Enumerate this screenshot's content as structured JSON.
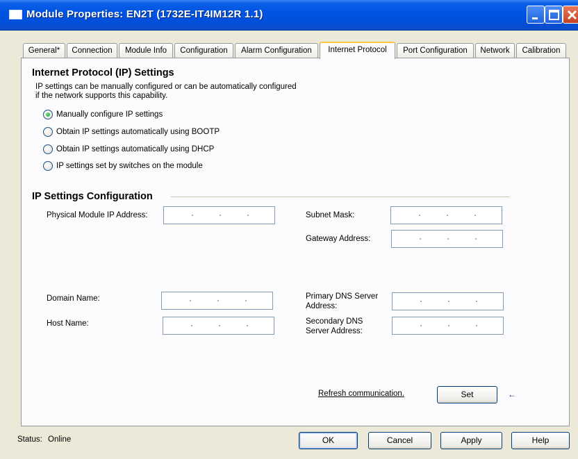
{
  "window": {
    "title": "Module Properties: EN2T (1732E-IT4IM12R 1.1)",
    "icon": "window-app-icon"
  },
  "tabs": [
    {
      "label": "General*"
    },
    {
      "label": "Connection"
    },
    {
      "label": "Module Info"
    },
    {
      "label": "Configuration"
    },
    {
      "label": "Alarm Configuration"
    },
    {
      "label": "Internet Protocol",
      "active": true
    },
    {
      "label": "Port Configuration"
    },
    {
      "label": "Network"
    },
    {
      "label": "Calibration"
    }
  ],
  "ip_settings": {
    "heading": "Internet Protocol (IP) Settings",
    "description_line1": "IP settings can be manually configured or can be automatically configured",
    "description_line2": "if the network supports this capability.",
    "options": [
      {
        "label": "Manually configure IP settings",
        "checked": true
      },
      {
        "label": "Obtain IP settings automatically using BOOTP",
        "checked": false
      },
      {
        "label": "Obtain IP settings automatically using DHCP",
        "checked": false
      },
      {
        "label": "IP settings set by switches on the module",
        "checked": false
      }
    ]
  },
  "config": {
    "heading": "IP Settings Configuration",
    "physical_ip_label": "Physical Module IP Address:",
    "physical_ip_value": "",
    "subnet_label": "Subnet Mask:",
    "subnet_value": "",
    "gateway_label": "Gateway Address:",
    "gateway_value": "",
    "domain_label": "Domain Name:",
    "domain_value": "",
    "host_label": "Host Name:",
    "host_value": "",
    "primary_dns_label_1": "Primary DNS Server",
    "primary_dns_label_2": "Address:",
    "primary_dns_value": "",
    "secondary_dns_label_1": "Secondary DNS",
    "secondary_dns_label_2": "Server Address:",
    "secondary_dns_value": ""
  },
  "actions": {
    "refresh_link": "Refresh communication.",
    "set_button": "Set",
    "set_arrow": "←"
  },
  "footer": {
    "status_label": "Status:",
    "status_value": "Online",
    "ok": "OK",
    "cancel": "Cancel",
    "apply": "Apply",
    "help": "Help"
  },
  "colors": {
    "titlebar": "#0054e3",
    "active_tab_accent": "#ffc83c",
    "dialog_bg": "#ece9d8"
  }
}
